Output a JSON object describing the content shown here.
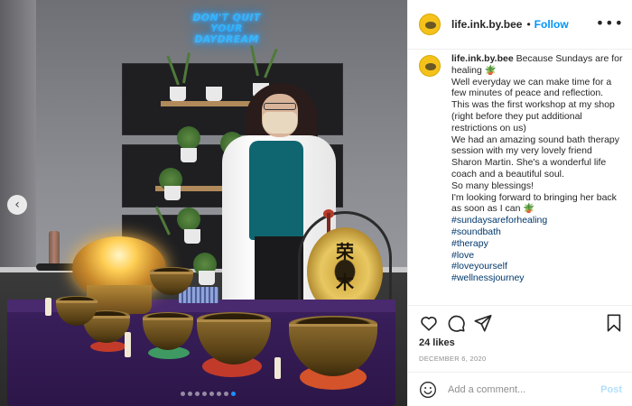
{
  "photo": {
    "neon_sign": "DON'T QUIT YOUR DAYDREAM",
    "gong_glyph": "荣\n木",
    "carousel": {
      "total_dots": 8,
      "active_index": 7
    }
  },
  "header": {
    "username": "life.ink.by.bee",
    "separator": "•",
    "follow_label": "Follow",
    "more_icon": "more-horizontal-icon"
  },
  "caption": {
    "username": "life.ink.by.bee",
    "first_line": "Because Sundays are for healing 🪴",
    "lines": [
      "Well everyday we can make time for a few minutes of peace and reflection.",
      "This was the first workshop at my shop (right before they put additional restrictions on us)",
      "We had an amazing sound bath therapy session with my very lovely friend Sharon Martin. She's a wonderful life coach and a beautiful soul.",
      "So many blessings!",
      "I'm looking forward to bringing her back as soon as I can 🪴"
    ],
    "hashtags": [
      "#sundaysareforhealing",
      "#soundbath",
      "#therapy",
      "#love",
      "#loveyourself",
      "#wellnessjourney"
    ]
  },
  "actions": {
    "like_icon": "heart-icon",
    "comment_icon": "comment-icon",
    "share_icon": "share-icon",
    "save_icon": "bookmark-icon"
  },
  "likes": "24 likes",
  "date": "DECEMBER 6, 2020",
  "comment_box": {
    "emoji_icon": "smiley-icon",
    "placeholder": "Add a comment...",
    "post_label": "Post"
  },
  "colors": {
    "accent": "#0095f6",
    "hashtag": "#00376b",
    "muted": "#8e8e8e",
    "tablecloth": "#3a1f5c",
    "neon": "#36b6ff"
  }
}
